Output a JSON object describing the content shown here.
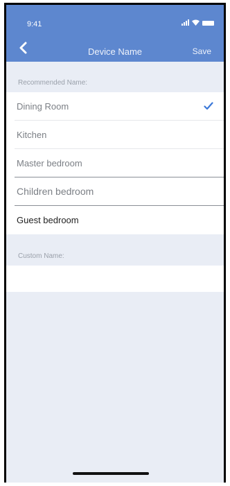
{
  "status_bar": {
    "time": "9:41"
  },
  "nav": {
    "title": "Device Name",
    "save_label": "Save"
  },
  "recommended": {
    "header": "Recommended Name:",
    "items": [
      {
        "label": "Dining Room",
        "selected": true
      },
      {
        "label": "Kitchen",
        "selected": false
      },
      {
        "label": "Master bedroom",
        "selected": false
      },
      {
        "label": "Children bedroom",
        "selected": false
      },
      {
        "label": "Guest bedroom",
        "selected": false
      }
    ]
  },
  "custom": {
    "header": "Custom Name:",
    "value": ""
  },
  "colors": {
    "accent": "#5d87cf",
    "check": "#3b78d8",
    "background": "#e9edf5"
  }
}
